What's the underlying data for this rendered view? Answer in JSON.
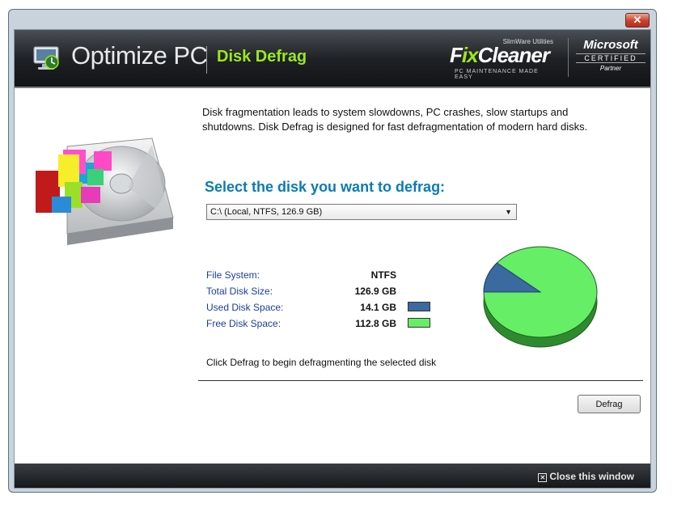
{
  "window": {
    "close_glyph": "✕"
  },
  "header": {
    "app_title": "Optimize PC",
    "module_title": "Disk Defrag",
    "partner_logo": {
      "small": "SlimWare Utilities",
      "name_a": "F",
      "name_x": "ix",
      "name_b": "Cleaner",
      "tagline": "PC MAINTENANCE MADE EASY"
    },
    "ms_logo": {
      "line1": "Microsoft",
      "line2": "CERTIFIED",
      "line3": "Partner"
    }
  },
  "main": {
    "description_bold": "Disk fragmentation leads to system slowdowns, PC crashes, slow startups and shutdowns.",
    "description_rest": " Disk Defrag is designed for fast defragmentation of modern hard disks.",
    "select_title": "Select the disk you want to defrag:",
    "disk_select": {
      "value": "C:\\ (Local, NTFS, 126.9 GB)"
    },
    "info": [
      {
        "label": "File System:",
        "value": "NTFS"
      },
      {
        "label": "Total Disk Size:",
        "value": "126.9 GB"
      },
      {
        "label": "Used Disk Space:",
        "value": "14.1 GB"
      },
      {
        "label": "Free Disk Space:",
        "value": "112.8 GB"
      }
    ],
    "colors": {
      "used": "#3a6aa0",
      "free": "#66ee66"
    },
    "usage": {
      "used_gb": 14.1,
      "free_gb": 112.8
    },
    "hint": "Click Defrag to begin defragmenting the selected disk",
    "defrag_label": "Defrag"
  },
  "footer": {
    "close_label": "Close this window",
    "close_glyph": "✕"
  }
}
